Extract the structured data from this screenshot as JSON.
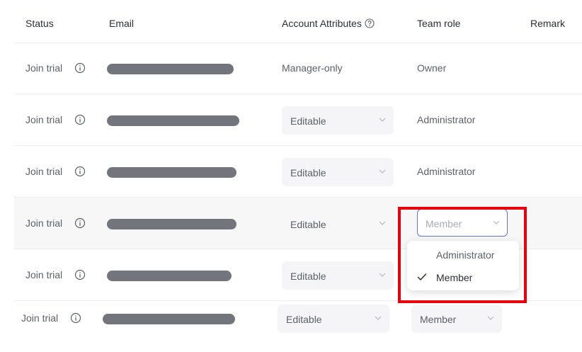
{
  "table": {
    "headers": {
      "status": "Status",
      "email": "Email",
      "account_attributes": "Account Attributes",
      "team_role": "Team role",
      "remark": "Remark"
    },
    "rows": [
      {
        "status": "Join trial",
        "attribute": "Manager-only",
        "role": "Owner"
      },
      {
        "status": "Join trial",
        "attribute": "Editable",
        "role": "Administrator"
      },
      {
        "status": "Join trial",
        "attribute": "Editable",
        "role": "Administrator"
      },
      {
        "status": "Join trial",
        "attribute": "Editable",
        "role": "Member"
      },
      {
        "status": "Join trial",
        "attribute": "Editable",
        "role": ""
      },
      {
        "status": "Join trial",
        "attribute": "Editable",
        "role": "Member"
      }
    ]
  },
  "role_dropdown": {
    "options": [
      "Administrator",
      "Member"
    ],
    "selected": "Member"
  },
  "colors": {
    "accent": "#6670e8",
    "highlight": "#e8000b",
    "redacted": "#72757b"
  }
}
